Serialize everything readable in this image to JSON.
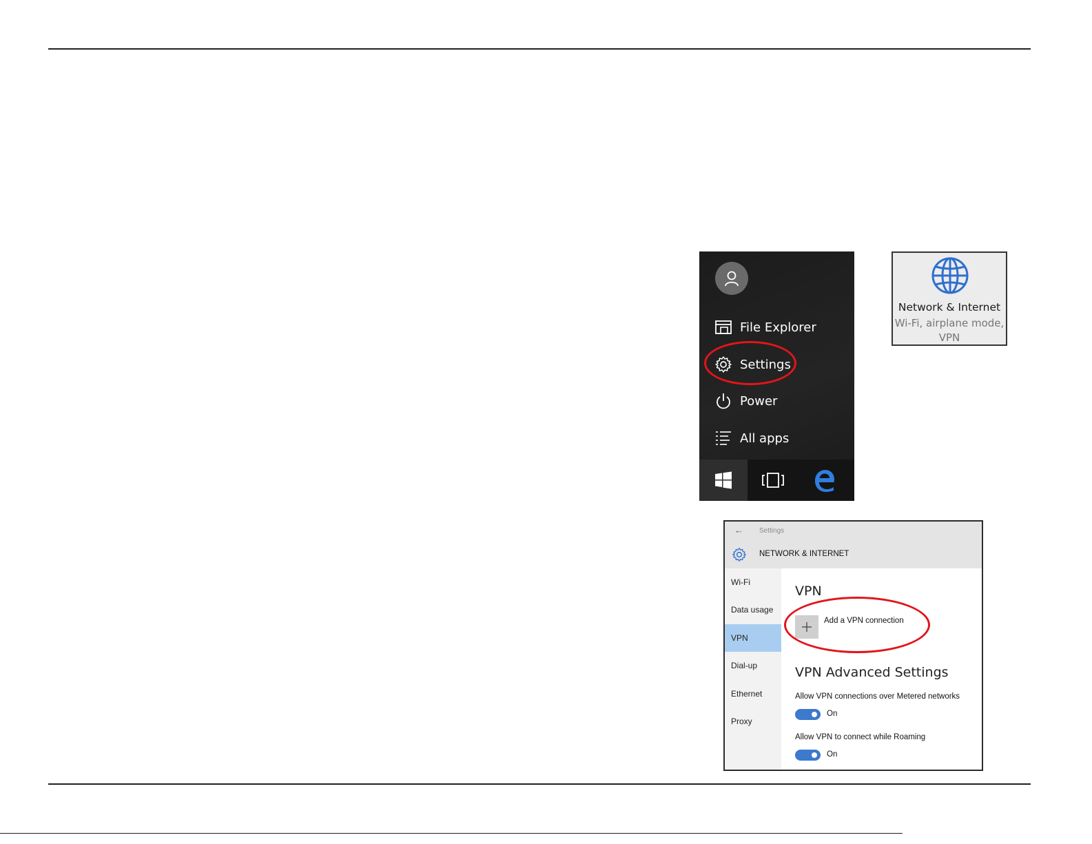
{
  "start_menu": {
    "items": [
      {
        "label": "File Explorer",
        "icon": "file-explorer-icon"
      },
      {
        "label": "Settings",
        "icon": "gear-icon"
      },
      {
        "label": "Power",
        "icon": "power-icon"
      },
      {
        "label": "All apps",
        "icon": "all-apps-icon"
      }
    ],
    "taskbar": [
      "windows-start-icon",
      "task-view-icon",
      "edge-icon"
    ]
  },
  "network_tile": {
    "title": "Network & Internet",
    "subtitle_line1": "Wi-Fi, airplane mode,",
    "subtitle_line2": "VPN",
    "icon": "globe-icon",
    "icon_color": "#2f6fcf"
  },
  "settings_window": {
    "breadcrumb": "Settings",
    "section_title": "NETWORK & INTERNET",
    "nav": [
      "Wi-Fi",
      "Data usage",
      "VPN",
      "Dial-up",
      "Ethernet",
      "Proxy"
    ],
    "active_nav": "VPN",
    "vpn_heading": "VPN",
    "add_vpn_label": "Add a VPN connection",
    "advanced_heading": "VPN Advanced Settings",
    "options": [
      {
        "label": "Allow VPN connections over Metered networks",
        "state": "On"
      },
      {
        "label": "Allow VPN to connect while Roaming",
        "state": "On"
      }
    ]
  },
  "colors": {
    "highlight_circle": "#e3141b",
    "toggle_on": "#3d79cc",
    "active_nav_bg": "#a9cdf0"
  }
}
